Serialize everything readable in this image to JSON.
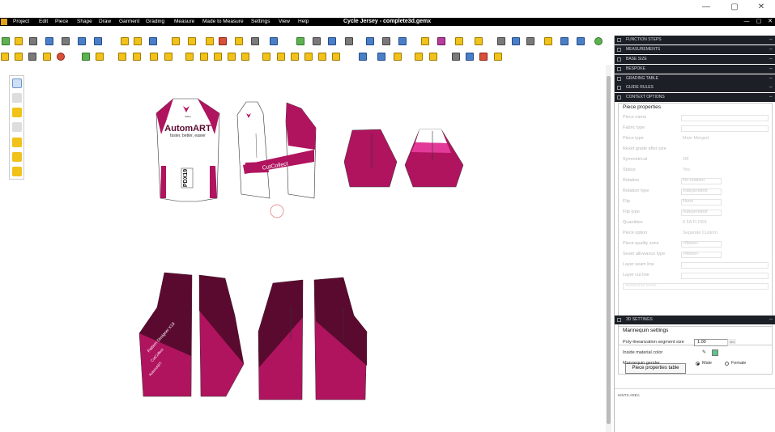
{
  "window": {
    "title": "Cycle Jersey - complete3d.gemx",
    "minimize": "—",
    "maximize": "▢",
    "close": "✕"
  },
  "menu": [
    "Project",
    "Edit",
    "Piece",
    "Shape",
    "Draw",
    "Garment",
    "Grading",
    "Measure",
    "Made to Measure",
    "Settings",
    "View",
    "Help"
  ],
  "colors": {
    "magenta": "#b0145f",
    "dark_maroon": "#5a0a2f",
    "pink": "#e33a9a",
    "panel_dark": "#1c1f26"
  },
  "panels": [
    "FUNCTION STEPS",
    "MEASUREMENTS",
    "BASE SIZE",
    "BESPOKE",
    "GRADING TABLE",
    "GUIDE RULES",
    "CONTEXT OPTIONS"
  ],
  "piece_properties": {
    "title": "Piece properties",
    "rows": [
      {
        "label": "Piece name",
        "value": "",
        "field": true
      },
      {
        "label": "Fabric type",
        "value": "",
        "field": true
      },
      {
        "label": "Piece type",
        "value": "Main      Merged",
        "field": false
      },
      {
        "label": "Reset grade after size",
        "value": "",
        "field": false
      },
      {
        "label": "Symmetrical",
        "value": "Off",
        "field": false
      },
      {
        "label": "Status",
        "value": "Yes",
        "field": false
      },
      {
        "label": "Rotation",
        "value": "No rotation",
        "field": true
      },
      {
        "label": "Rotation type",
        "value": "Independent",
        "field": true
      },
      {
        "label": "Flip",
        "value": "None",
        "field": true
      },
      {
        "label": "Flip type",
        "value": "Independent",
        "field": true
      },
      {
        "label": "Quantities",
        "value": "0      FA      FI      FBS",
        "field": false
      },
      {
        "label": "Piece option",
        "value": "Separate      Custom",
        "field": false
      },
      {
        "label": "Piece quality zone",
        "value": "<None>",
        "field": true
      },
      {
        "label": "Seam allowance type",
        "value": "<None>",
        "field": true
      },
      {
        "label": "Layer seam line",
        "value": "",
        "field": true
      },
      {
        "label": "Layer cut line",
        "value": "",
        "field": true
      },
      {
        "label": "Additional fields",
        "value": "",
        "field": true
      }
    ],
    "table_button": "Piece properties table"
  },
  "settings_3d": {
    "header": "3D SETTINGS",
    "title": "Mannequin settings",
    "segment_label": "Poly-linearization segment size",
    "segment_value": "1.00",
    "segment_unit": "cm",
    "inside_label": "Inside material color",
    "gender_label": "Mannequin gender",
    "gender_male": "Male",
    "gender_female": "Female",
    "gender_selected": "Male"
  },
  "hints": "HINTS AREA",
  "garment": {
    "brand": "AutomART",
    "tagline": "faster, better, easier",
    "logo_text": "Valley",
    "side_left": "Automart",
    "side_right": "CutCollect",
    "code": "PDX19",
    "sleeve_text": "CutCollect",
    "short_left": "Pattern Designer X19",
    "short_mid": "CutCollect",
    "short_low": "AutomART"
  }
}
